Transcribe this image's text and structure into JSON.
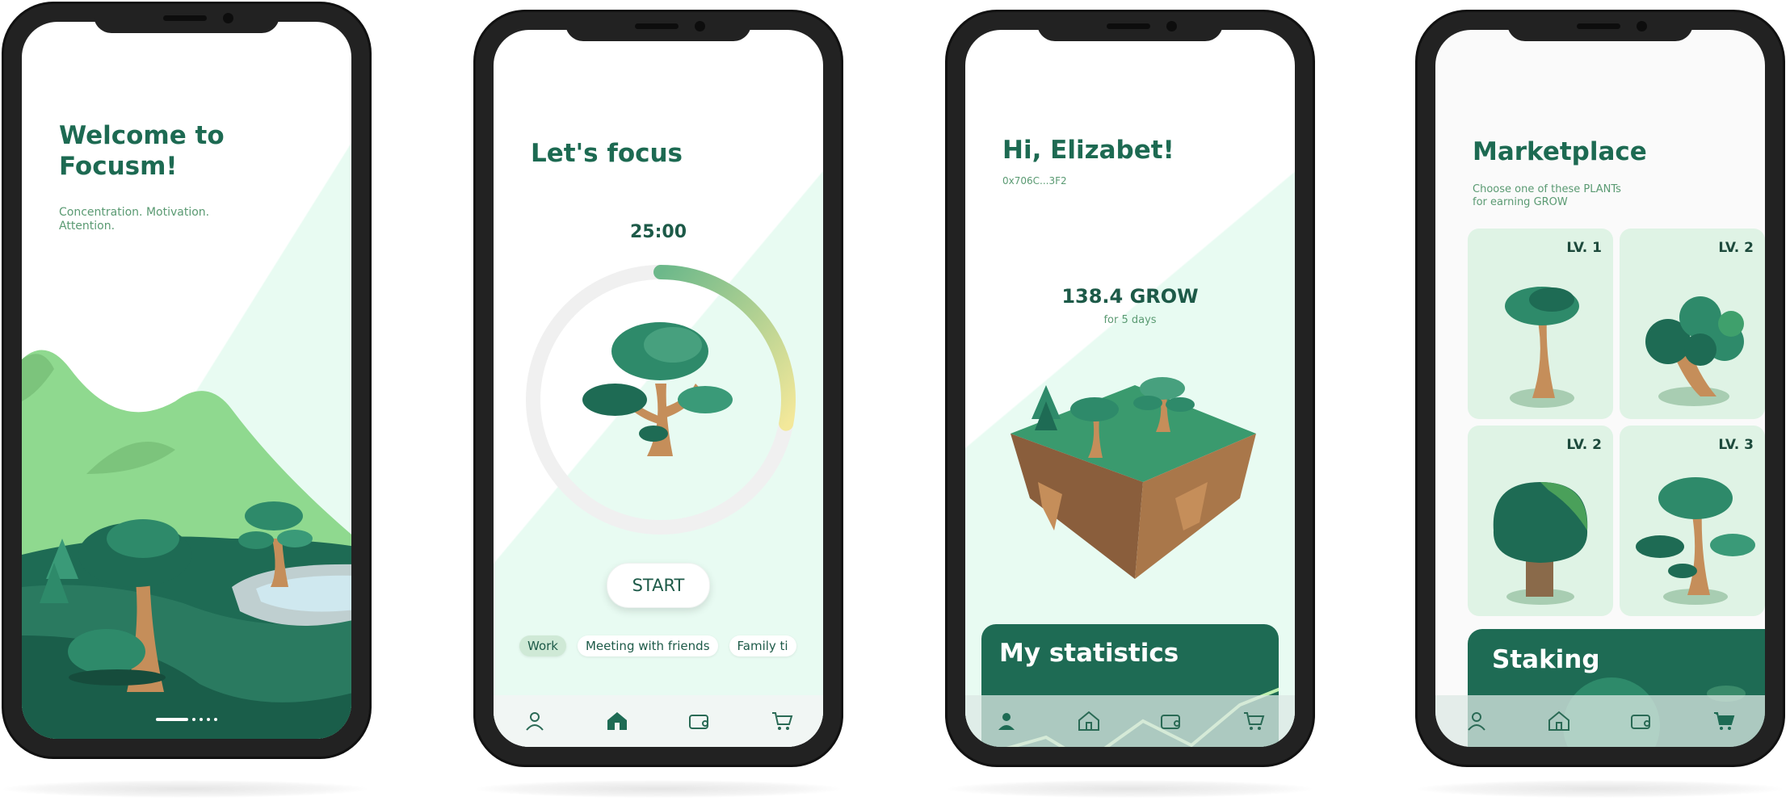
{
  "welcome": {
    "title_line1": "Welcome to",
    "title_line2": "Focusm!",
    "tagline_line1": "Concentration. Motivation.",
    "tagline_line2": "Attention."
  },
  "focus": {
    "title": "Let's focus",
    "timer": "25:00",
    "timer_progress": 0.28,
    "start_label": "START",
    "chips": [
      "Work",
      "Meeting with friends",
      "Family ti"
    ]
  },
  "home": {
    "greeting": "Hi, Elizabet!",
    "wallet": "0x706C...3F2",
    "balance": "138.4 GROW",
    "period": "for 5 days",
    "stats_title": "My statistics"
  },
  "market": {
    "title": "Marketplace",
    "subtitle_line1": "Choose one of these  PLANTs",
    "subtitle_line2": "for earning GROW",
    "plants": [
      {
        "level": "LV. 1"
      },
      {
        "level": "LV. 2"
      },
      {
        "level": "LV. 2"
      },
      {
        "level": "LV. 3"
      }
    ],
    "staking_title": "Staking"
  },
  "nav_icons": [
    "user-icon",
    "home-icon",
    "wallet-icon",
    "cart-icon"
  ],
  "colors": {
    "primary": "#1e6b54",
    "accent_mint": "#e8fbf2",
    "text_green": "#1d6a52",
    "muted_green": "#5a9a72"
  }
}
